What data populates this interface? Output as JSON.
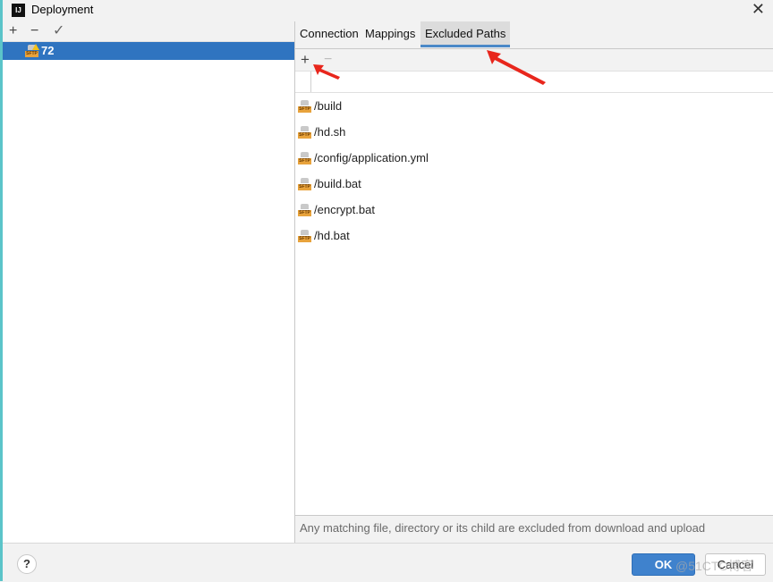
{
  "window": {
    "title": "Deployment",
    "app_icon": "intellij-idea-icon",
    "close_icon": "close-icon"
  },
  "left_toolbar": {
    "add": "+",
    "remove": "−",
    "apply": "✓"
  },
  "tree": {
    "items": [
      {
        "label": "72",
        "icon": "sftp-server-warning-icon",
        "selected": true
      }
    ]
  },
  "tabs": [
    {
      "label": "Connection",
      "active": false
    },
    {
      "label": "Mappings",
      "active": false
    },
    {
      "label": "Excluded Paths",
      "active": true
    }
  ],
  "right_toolbar": {
    "add": "+",
    "remove": "−"
  },
  "excluded_paths": [
    {
      "path": "/build",
      "icon": "sftp-icon"
    },
    {
      "path": "/hd.sh",
      "icon": "sftp-icon"
    },
    {
      "path": "/config/application.yml",
      "icon": "sftp-icon"
    },
    {
      "path": "/build.bat",
      "icon": "sftp-icon"
    },
    {
      "path": "/encrypt.bat",
      "icon": "sftp-icon"
    },
    {
      "path": "/hd.bat",
      "icon": "sftp-icon"
    }
  ],
  "hint": "Any matching file, directory or its child are excluded from download and upload",
  "footer": {
    "help": "?",
    "ok": "OK",
    "cancel": "Cancel",
    "watermark": "@51CTO博客"
  },
  "sftp_label": "SFTP",
  "colors": {
    "selection": "#2f74c0",
    "tab_underline": "#4a88c7",
    "ok_button": "#3f82cd",
    "annotation_arrow": "#e8261c"
  }
}
